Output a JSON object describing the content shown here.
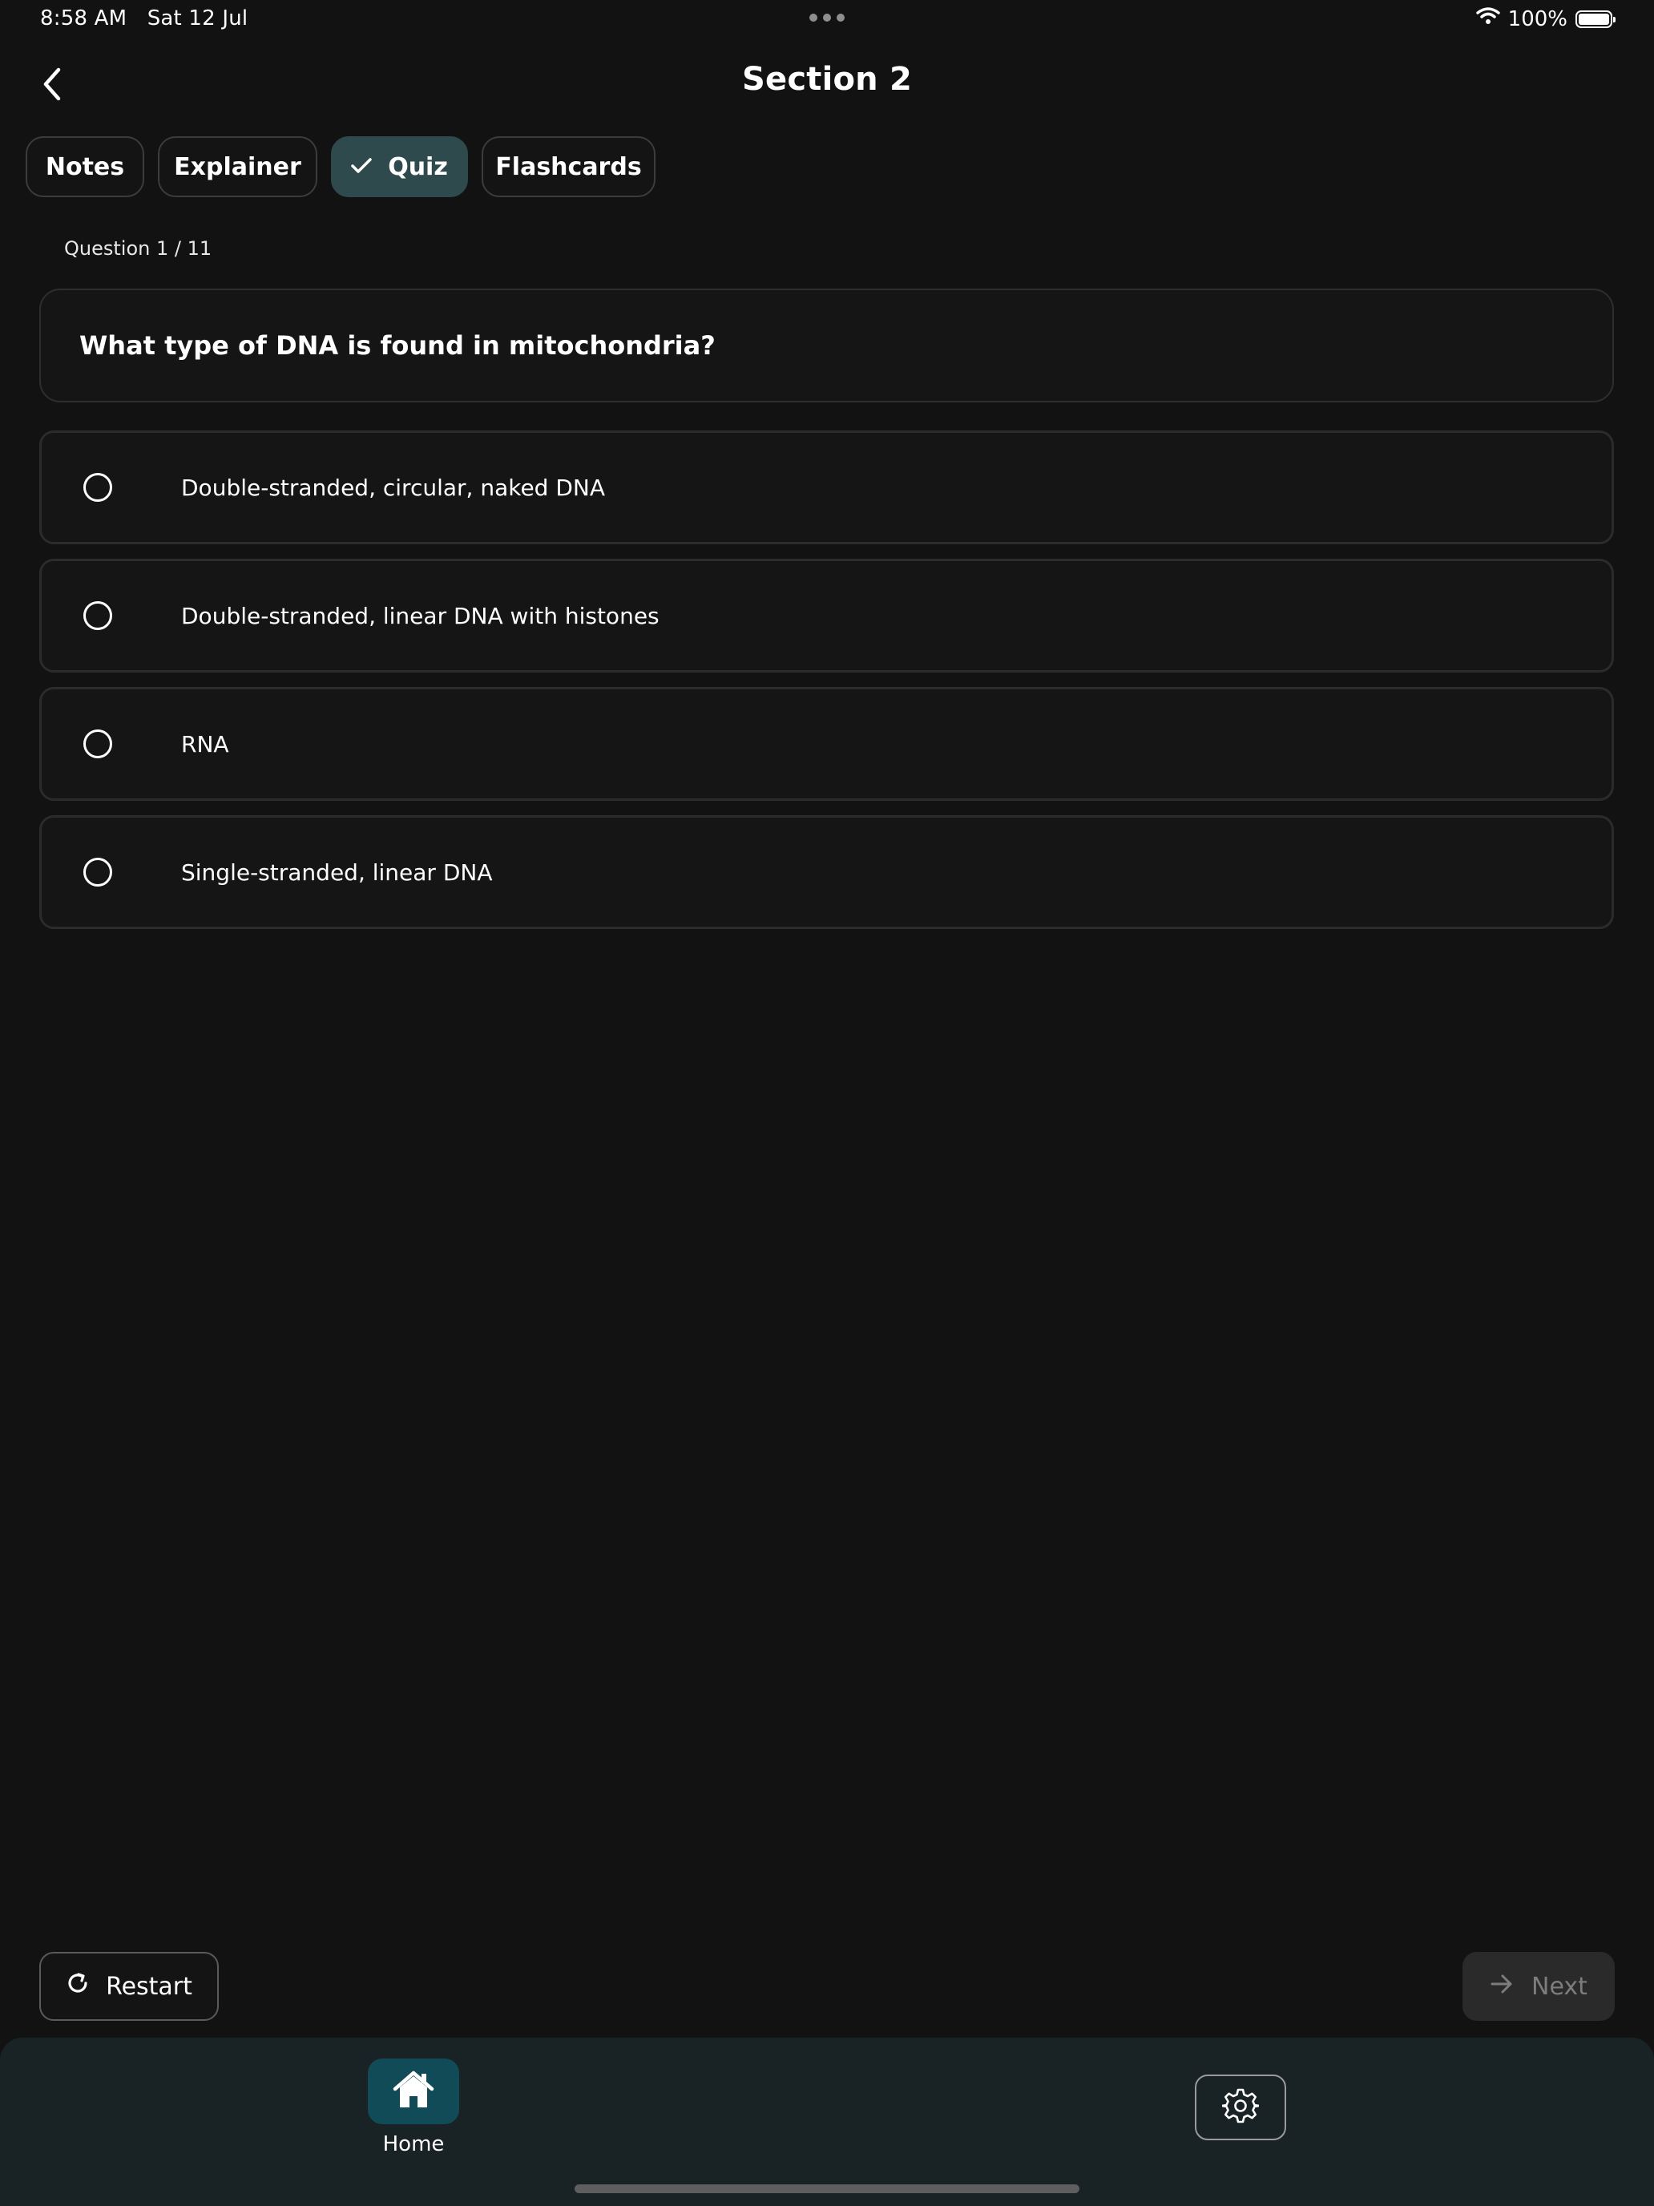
{
  "status_bar": {
    "time": "8:58 AM",
    "date": "Sat 12 Jul",
    "battery": "100%"
  },
  "header": {
    "title": "Section 2"
  },
  "tabs": [
    {
      "label": "Notes",
      "active": false
    },
    {
      "label": "Explainer",
      "active": false
    },
    {
      "label": "Quiz",
      "active": true
    },
    {
      "label": "Flashcards",
      "active": false
    }
  ],
  "quiz": {
    "counter": "Question 1 / 11",
    "question": "What type of DNA is found in mitochondria?",
    "options": [
      "Double-stranded, circular, naked DNA",
      "Double-stranded, linear DNA with histones",
      "RNA",
      "Single-stranded, linear DNA"
    ]
  },
  "actions": {
    "restart_label": "Restart",
    "next_label": "Next"
  },
  "bottom_nav": {
    "home_label": "Home"
  },
  "colors": {
    "background": "#121212",
    "active_tab": "#2f4a4c",
    "home_accent": "#114b57",
    "nav_background": "#192224"
  },
  "icons": {
    "back": "chevron-left-icon",
    "quiz_tab": "checkmark-icon",
    "restart": "refresh-icon",
    "next": "arrow-right-icon",
    "home": "house-icon",
    "settings": "gear-icon"
  }
}
